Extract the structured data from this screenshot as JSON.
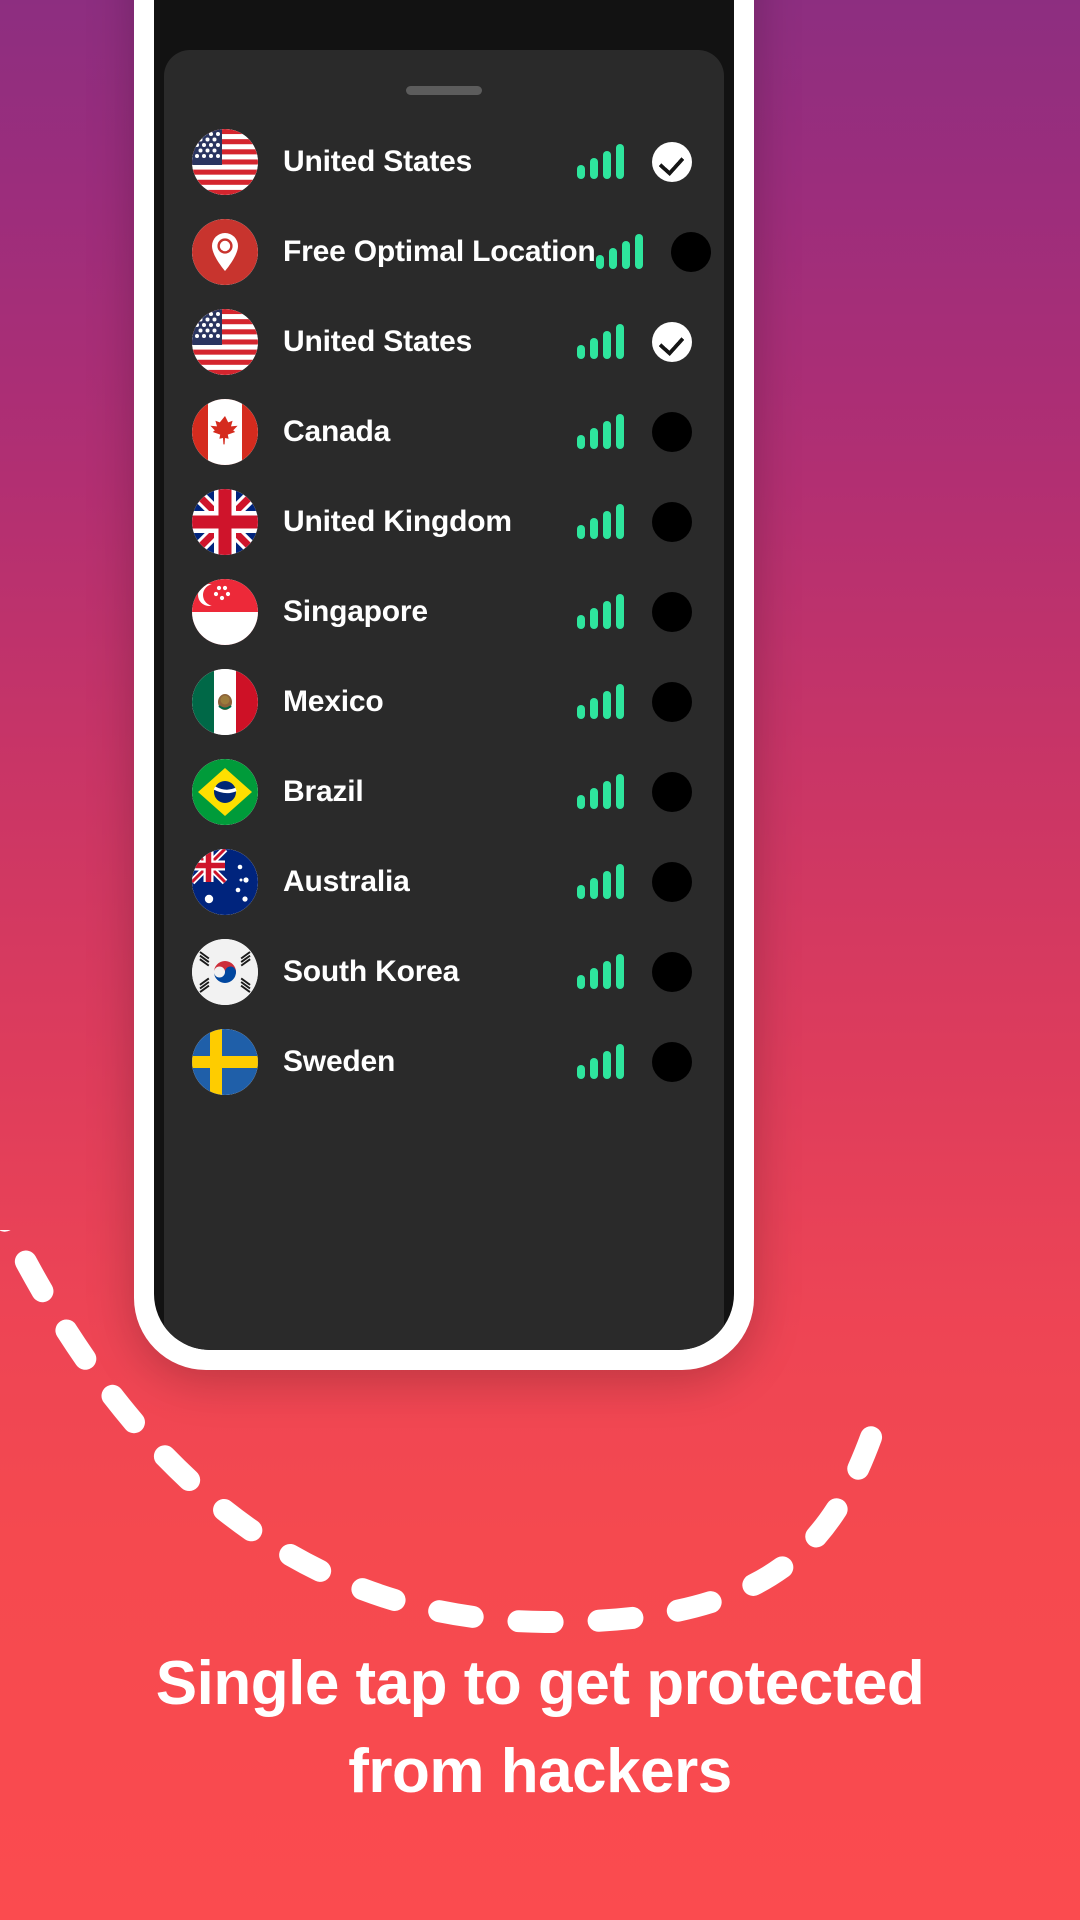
{
  "background": {
    "gradient_top": "#8d2e80",
    "gradient_mid": "#d13a60",
    "gradient_bottom": "#fb4b4f"
  },
  "phone": {
    "frame_color": "#ffffff",
    "screen_color": "#121212",
    "sheet_color": "#2a2a2a",
    "handle_name": "sheet-drag-handle"
  },
  "theme": {
    "signal_green": "#2ee59d",
    "selected_circle": "#ffffff",
    "unselected_circle": "#000000",
    "text_color": "#ffffff",
    "pin_red": "#c8342e"
  },
  "locations": [
    {
      "name": "United States",
      "icon": "flag-us",
      "signal": 4,
      "selected": true
    },
    {
      "name": "Free Optimal Location",
      "icon": "map-pin",
      "signal": 4,
      "selected": false
    },
    {
      "name": "United States",
      "icon": "flag-us",
      "signal": 4,
      "selected": true
    },
    {
      "name": "Canada",
      "icon": "flag-ca",
      "signal": 4,
      "selected": false
    },
    {
      "name": "United Kingdom",
      "icon": "flag-gb",
      "signal": 4,
      "selected": false
    },
    {
      "name": "Singapore",
      "icon": "flag-sg",
      "signal": 4,
      "selected": false
    },
    {
      "name": "Mexico",
      "icon": "flag-mx",
      "signal": 4,
      "selected": false
    },
    {
      "name": "Brazil",
      "icon": "flag-br",
      "signal": 4,
      "selected": false
    },
    {
      "name": "Australia",
      "icon": "flag-au",
      "signal": 4,
      "selected": false
    },
    {
      "name": "South Korea",
      "icon": "flag-kr",
      "signal": 4,
      "selected": false
    },
    {
      "name": "Sweden",
      "icon": "flag-se",
      "signal": 4,
      "selected": false
    }
  ],
  "headline": {
    "line1": "Single tap to get protected",
    "line2": "from hackers",
    "full": "Single tap to get protected from hackers"
  },
  "decoration": {
    "arc_name": "dashed-arc",
    "arc_color": "#ffffff"
  }
}
